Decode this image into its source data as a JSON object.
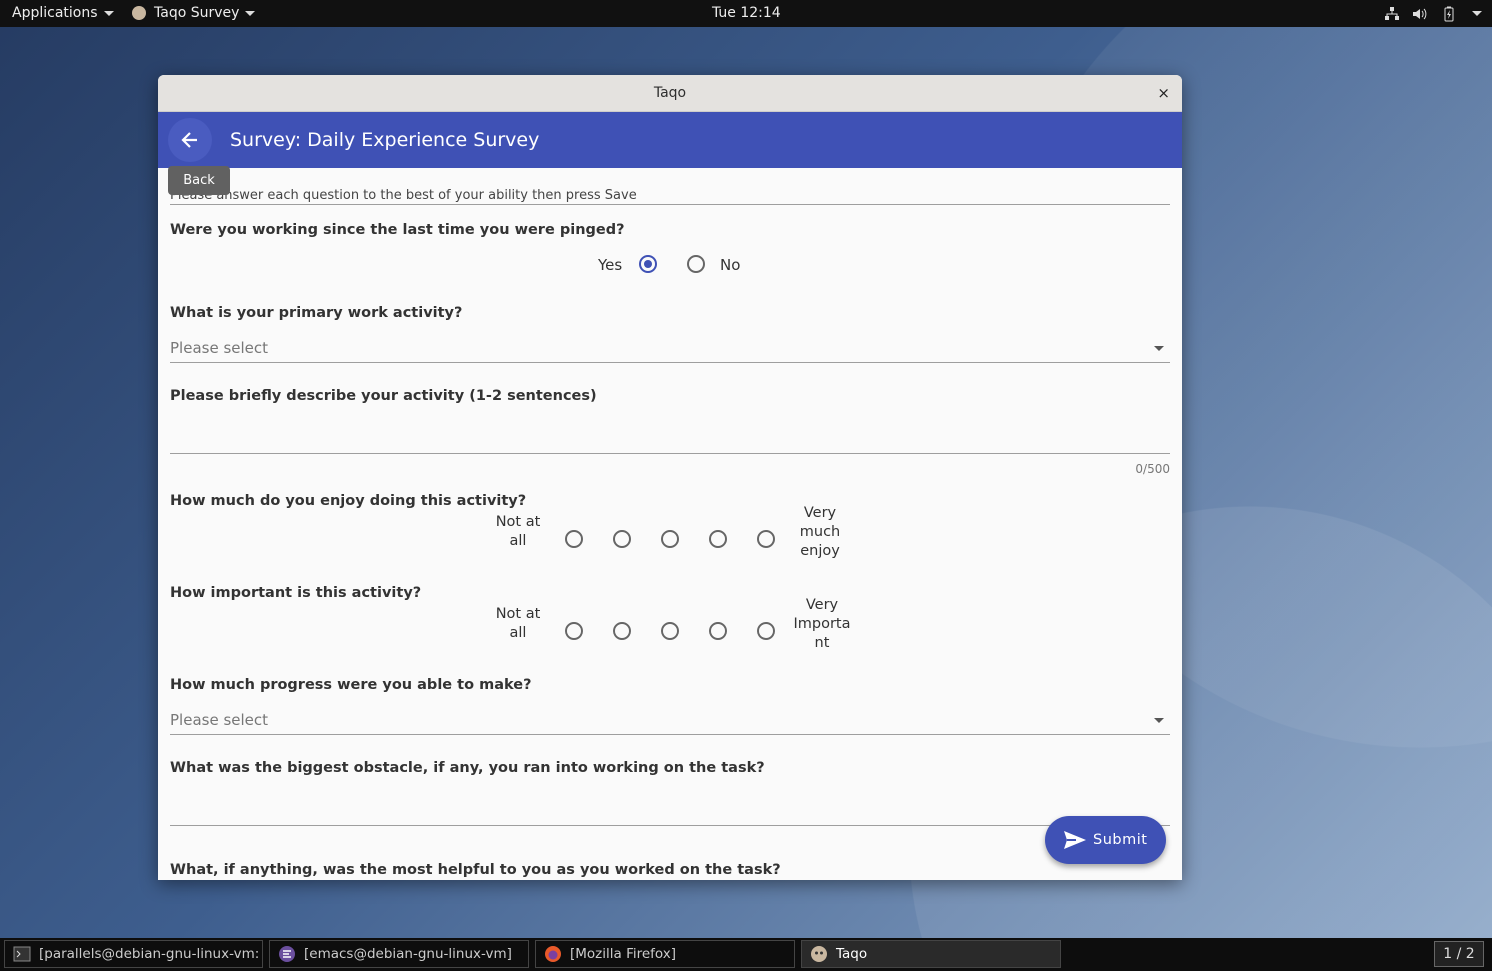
{
  "topbar": {
    "applications": "Applications",
    "app_name": "Taqo Survey",
    "clock": "Tue 12:14"
  },
  "window": {
    "title": "Taqo",
    "close": "×"
  },
  "appbar": {
    "title": "Survey: Daily Experience Survey",
    "back_tooltip": "Back"
  },
  "survey": {
    "instructions": "Please answer each question to the best of your ability then press Save",
    "q1": {
      "text": "Were you working since the last time you were pinged?",
      "options": [
        "Yes",
        "No"
      ],
      "selected": "Yes"
    },
    "q2": {
      "text": "What is your primary work activity?",
      "placeholder": "Please select"
    },
    "q3": {
      "text": "Please briefly describe your activity (1-2 sentences)",
      "counter": "0/500"
    },
    "q4": {
      "text": "How much do you enjoy doing this activity?",
      "left": "Not at all",
      "right": "Very much enjoy"
    },
    "q5": {
      "text": "How important is this activity?",
      "left": "Not at all",
      "right": "Very Importa nt"
    },
    "q6": {
      "text": "How much progress were you able to make?",
      "placeholder": "Please select"
    },
    "q7": {
      "text": "What was the biggest obstacle, if any, you ran into working on the task?"
    },
    "q8_partial": "What, if anything, was the most helpful to you as you worked on the task?"
  },
  "submit_label": "Submit",
  "taskbar": {
    "tasks": [
      "[parallels@debian-gnu-linux-vm: ...",
      "[emacs@debian-gnu-linux-vm]",
      "[Mozilla Firefox]",
      "Taqo"
    ],
    "pager": "1 / 2"
  },
  "colors": {
    "primary": "#3f51b5",
    "titlebar": "#e4e2df",
    "topbar": "#111111"
  }
}
